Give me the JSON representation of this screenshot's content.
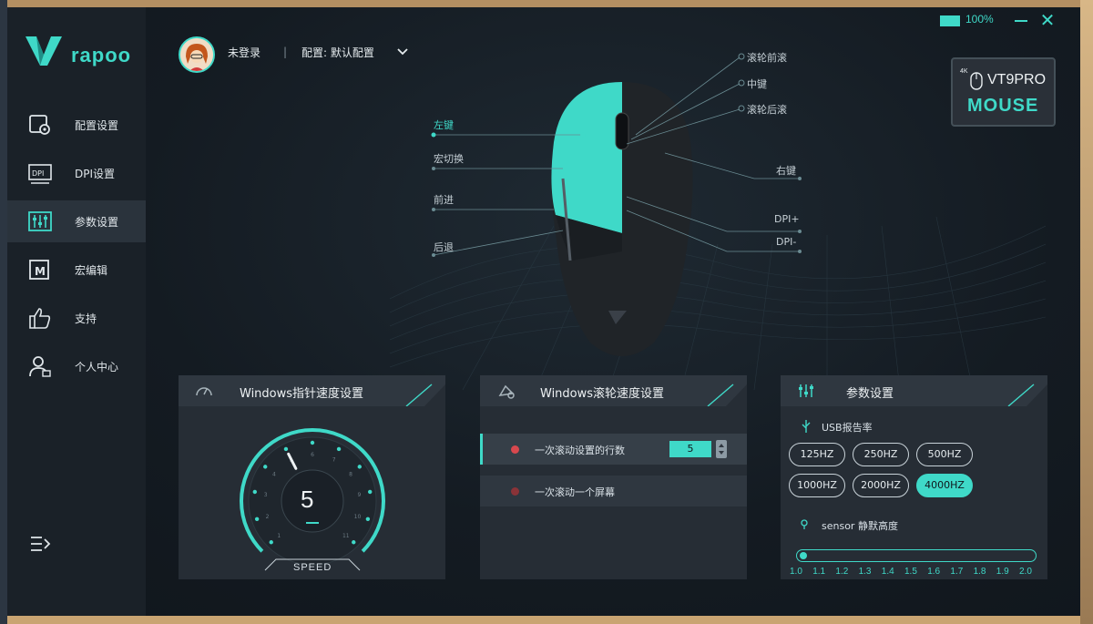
{
  "window": {
    "battery_label": "100%"
  },
  "brand": {
    "logo_text": "rapoo"
  },
  "sidebar": {
    "items": [
      {
        "label": "配置设置",
        "icon": "gear-config-icon"
      },
      {
        "label": "DPI设置",
        "icon": "dpi-icon"
      },
      {
        "label": "参数设置",
        "icon": "sliders-icon",
        "active": true
      },
      {
        "label": "宏编辑",
        "icon": "macro-icon"
      },
      {
        "label": "支持",
        "icon": "thumbs-up-icon"
      },
      {
        "label": "个人中心",
        "icon": "user-icon"
      }
    ]
  },
  "header": {
    "user_label": "未登录",
    "separator": "|",
    "config_label": "配置: 默认配置"
  },
  "device": {
    "badge_4k": "4K",
    "model": "VT9PRO",
    "type": "MOUSE"
  },
  "mouse_buttons": {
    "left": "左键",
    "macro_switch": "宏切换",
    "forward": "前进",
    "back": "后退",
    "wheel_forward": "滚轮前滚",
    "middle": "中键",
    "wheel_back": "滚轮后滚",
    "right": "右键",
    "dpi_plus": "DPI+",
    "dpi_minus": "DPI-"
  },
  "pointer_panel": {
    "title": "Windows指针速度设置",
    "value": "5",
    "speed_label": "SPEED",
    "gauge_ticks": [
      "1",
      "2",
      "3",
      "4",
      "5",
      "6",
      "7",
      "8",
      "9",
      "10",
      "11"
    ],
    "level_fraction": 0.4
  },
  "scroll_panel": {
    "title": "Windows滚轮速度设置",
    "row1_label": "一次滚动设置的行数",
    "row1_value": "5",
    "row2_label": "一次滚动一个屏幕"
  },
  "param_panel": {
    "title": "参数设置",
    "usb_label": "USB报告率",
    "rates": [
      "125HZ",
      "250HZ",
      "500HZ",
      "1000HZ",
      "2000HZ",
      "4000HZ"
    ],
    "selected_rate": "4000HZ",
    "sensor_label": "sensor 静默高度",
    "lod_ticks": [
      "1.0",
      "1.1",
      "1.2",
      "1.3",
      "1.4",
      "1.5",
      "1.6",
      "1.7",
      "1.8",
      "1.9",
      "2.0"
    ],
    "lod_value": "1.0"
  },
  "colors": {
    "accent": "#3fd9c8",
    "panel": "#262d35",
    "sidebar": "#1a2128",
    "red_dot": "#d8484e"
  }
}
